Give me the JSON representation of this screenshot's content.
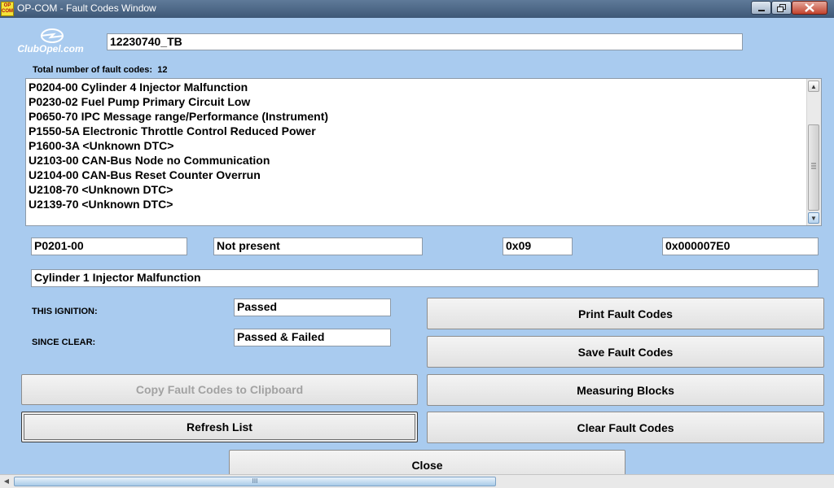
{
  "window": {
    "title": "OP-COM - Fault Codes Window",
    "icon_text_top": "OP",
    "icon_text_bottom": "COM",
    "logo_text": "ClubOpel.com"
  },
  "ecu_id": "12230740_TB",
  "total_label": "Total number of fault codes:",
  "total_count": "12",
  "fault_list": [
    "P0204-00 Cylinder 4 Injector Malfunction",
    "P0230-02 Fuel Pump Primary Circuit Low",
    "P0650-70 IPC Message range/Performance (Instrument)",
    "P1550-5A Electronic Throttle Control Reduced Power",
    "P1600-3A <Unknown DTC>",
    "U2103-00 CAN-Bus Node no Communication",
    "U2104-00 CAN-Bus Reset Counter Overrun",
    "U2108-70 <Unknown DTC>",
    "U2139-70 <Unknown DTC>"
  ],
  "selected": {
    "code": "P0201-00",
    "presence": "Not present",
    "status_byte": "0x09",
    "address": "0x000007E0",
    "description": "Cylinder 1 Injector Malfunction"
  },
  "this_ignition_label": "THIS IGNITION:",
  "this_ignition_value": "Passed",
  "since_clear_label": "SINCE CLEAR:",
  "since_clear_value": "Passed & Failed",
  "buttons": {
    "copy": "Copy Fault Codes to Clipboard",
    "refresh": "Refresh List",
    "print": "Print Fault Codes",
    "save": "Save Fault Codes",
    "measuring": "Measuring Blocks",
    "clear": "Clear Fault Codes",
    "close": "Close"
  },
  "icons": {
    "minimize": "minimize-icon",
    "maximize": "maximize-icon",
    "close": "close-icon",
    "scroll_up": "scroll-up-arrow-icon",
    "scroll_down": "scroll-down-arrow-icon",
    "scroll_left": "scroll-left-arrow-icon",
    "grip": "scroll-grip-icon"
  },
  "colors": {
    "window_bg": "#a9cbef",
    "title_bar": "#3e5877",
    "close_button": "#c2432e"
  }
}
